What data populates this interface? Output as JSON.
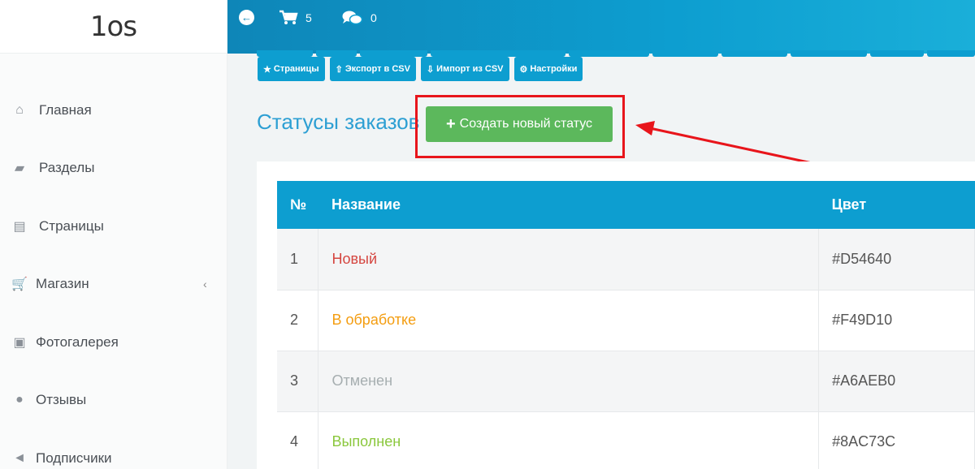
{
  "brand": {
    "logo_text": "1os"
  },
  "sidebar": {
    "items": [
      {
        "label": "Главная",
        "icon": "home-icon",
        "glyph": "⌂"
      },
      {
        "label": "Разделы",
        "icon": "folder-open-icon",
        "glyph": "▰"
      },
      {
        "label": "Страницы",
        "icon": "file-icon",
        "glyph": "▤"
      },
      {
        "label": "Магазин",
        "icon": "cart-icon",
        "glyph": "🛒",
        "chevron": "‹"
      },
      {
        "label": "Фотогалерея",
        "icon": "camera-icon",
        "glyph": "▣"
      },
      {
        "label": "Отзывы",
        "icon": "comments-icon",
        "glyph": "●"
      },
      {
        "label": "Подписчики",
        "icon": "bullhorn-icon",
        "glyph": "◄"
      }
    ]
  },
  "topbar": {
    "back_glyph": "←",
    "cart_count": "5",
    "comments_count": "0"
  },
  "toolbar": {
    "buttons": [
      {
        "label": "Страницы",
        "glyph": "★"
      },
      {
        "label": "Экспорт в CSV",
        "glyph": "⇧"
      },
      {
        "label": "Импорт из CSV",
        "glyph": "⇩"
      },
      {
        "label": "Настройки",
        "glyph": "⚙"
      }
    ]
  },
  "page": {
    "title": "Статусы заказов",
    "create_label": "Создать новый статус",
    "create_glyph": "+"
  },
  "table": {
    "headers": [
      "№",
      "Название",
      "Цвет"
    ],
    "rows": [
      {
        "num": "1",
        "name": "Новый",
        "color": "#D54640"
      },
      {
        "num": "2",
        "name": "В обработке",
        "color": "#F49D10"
      },
      {
        "num": "3",
        "name": "Отменен",
        "color": "#A6AEB0"
      },
      {
        "num": "4",
        "name": "Выполнен",
        "color": "#8AC73C"
      }
    ]
  },
  "colors": {
    "accent": "#0D9ED0",
    "success": "#5CB85C",
    "annotation": "#E8151B"
  }
}
